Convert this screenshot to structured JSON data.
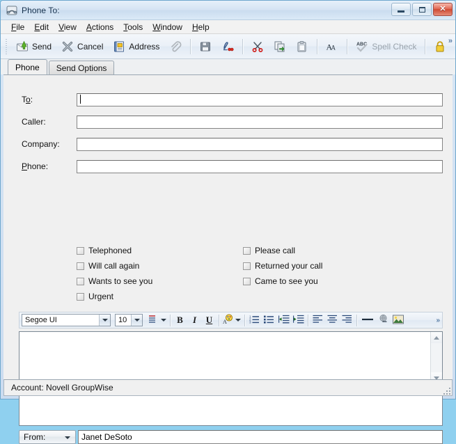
{
  "window": {
    "title": "Phone To:",
    "icon": "telephone-icon",
    "caption_buttons": [
      {
        "name": "minimize",
        "glyph": "minimize-glyph"
      },
      {
        "name": "maximize",
        "glyph": "maximize-glyph"
      },
      {
        "name": "close",
        "glyph": "✕"
      }
    ]
  },
  "menubar": {
    "items": [
      {
        "label": "File",
        "accel": "F"
      },
      {
        "label": "Edit",
        "accel": "E"
      },
      {
        "label": "View",
        "accel": "V"
      },
      {
        "label": "Actions",
        "accel": "A"
      },
      {
        "label": "Tools",
        "accel": "T"
      },
      {
        "label": "Window",
        "accel": "W"
      },
      {
        "label": "Help",
        "accel": "H"
      }
    ]
  },
  "toolbar": {
    "send_label": "Send",
    "cancel_label": "Cancel",
    "address_label": "Address",
    "spell_check_label": "Spell Check",
    "overflow_label": "»",
    "icons": {
      "send": "send-envelope-icon",
      "cancel": "cancel-x-icon",
      "address": "address-book-icon",
      "attach": "paperclip-icon",
      "save": "floppy-save-icon",
      "signature": "signature-icon",
      "cut": "scissors-icon",
      "copy": "copy-icon",
      "paste": "clipboard-paste-icon",
      "font": "font-AA-icon",
      "spell": "spell-check-abc-icon",
      "lock": "padlock-icon"
    }
  },
  "tabs": [
    {
      "label": "Phone",
      "active": true
    },
    {
      "label": "Send Options",
      "active": false
    }
  ],
  "form": {
    "fields": [
      {
        "label": "To:",
        "accel": "o",
        "pre": "T",
        "post": ":",
        "value": "",
        "focused": true
      },
      {
        "label": "Caller:",
        "accel": "",
        "pre": "Caller:",
        "post": "",
        "value": "",
        "focused": false
      },
      {
        "label": "Company:",
        "accel": "",
        "pre": "Company:",
        "post": "",
        "value": "",
        "focused": false
      },
      {
        "label": "Phone:",
        "accel": "P",
        "pre": "",
        "post": "hone:",
        "value": "",
        "focused": false
      }
    ],
    "checkboxes_left": [
      {
        "label": "Telephoned",
        "checked": false
      },
      {
        "label": "Will call again",
        "checked": false
      },
      {
        "label": "Wants to see you",
        "checked": false
      },
      {
        "label": "Urgent",
        "checked": false
      }
    ],
    "checkboxes_right": [
      {
        "label": "Please call",
        "checked": false
      },
      {
        "label": "Returned your call",
        "checked": false
      },
      {
        "label": "Came to see you",
        "checked": false
      }
    ]
  },
  "format_toolbar": {
    "font_name": "Segoe UI",
    "font_size": "10",
    "bold": "B",
    "italic": "I",
    "underline": "U",
    "overflow_label": "»",
    "icons": {
      "paragraph_style": "paragraph-style-icon",
      "font_color": "font-color-icon",
      "numbered_list": "numbered-list-icon",
      "bulleted_list": "bulleted-list-icon",
      "decrease_indent": "decrease-indent-icon",
      "increase_indent": "increase-indent-icon",
      "align_left": "align-left-icon",
      "align_center": "align-center-icon",
      "align_right": "align-right-icon",
      "horizontal_line": "horizontal-line-icon",
      "hyperlink": "hyperlink-icon",
      "insert_image": "insert-image-icon"
    }
  },
  "body": {
    "message_text": "",
    "signature_text": ""
  },
  "from": {
    "button_label": "From:",
    "value": "Janet DeSoto"
  },
  "statusbar": {
    "text": "Account: Novell GroupWise"
  },
  "colors": {
    "window_border": "#6ea7cd",
    "title_gradient_top": "#e6f0fa",
    "close_button": "#cf4a33",
    "page_background": "#f0f0f0",
    "field_background": "#ffffff"
  }
}
